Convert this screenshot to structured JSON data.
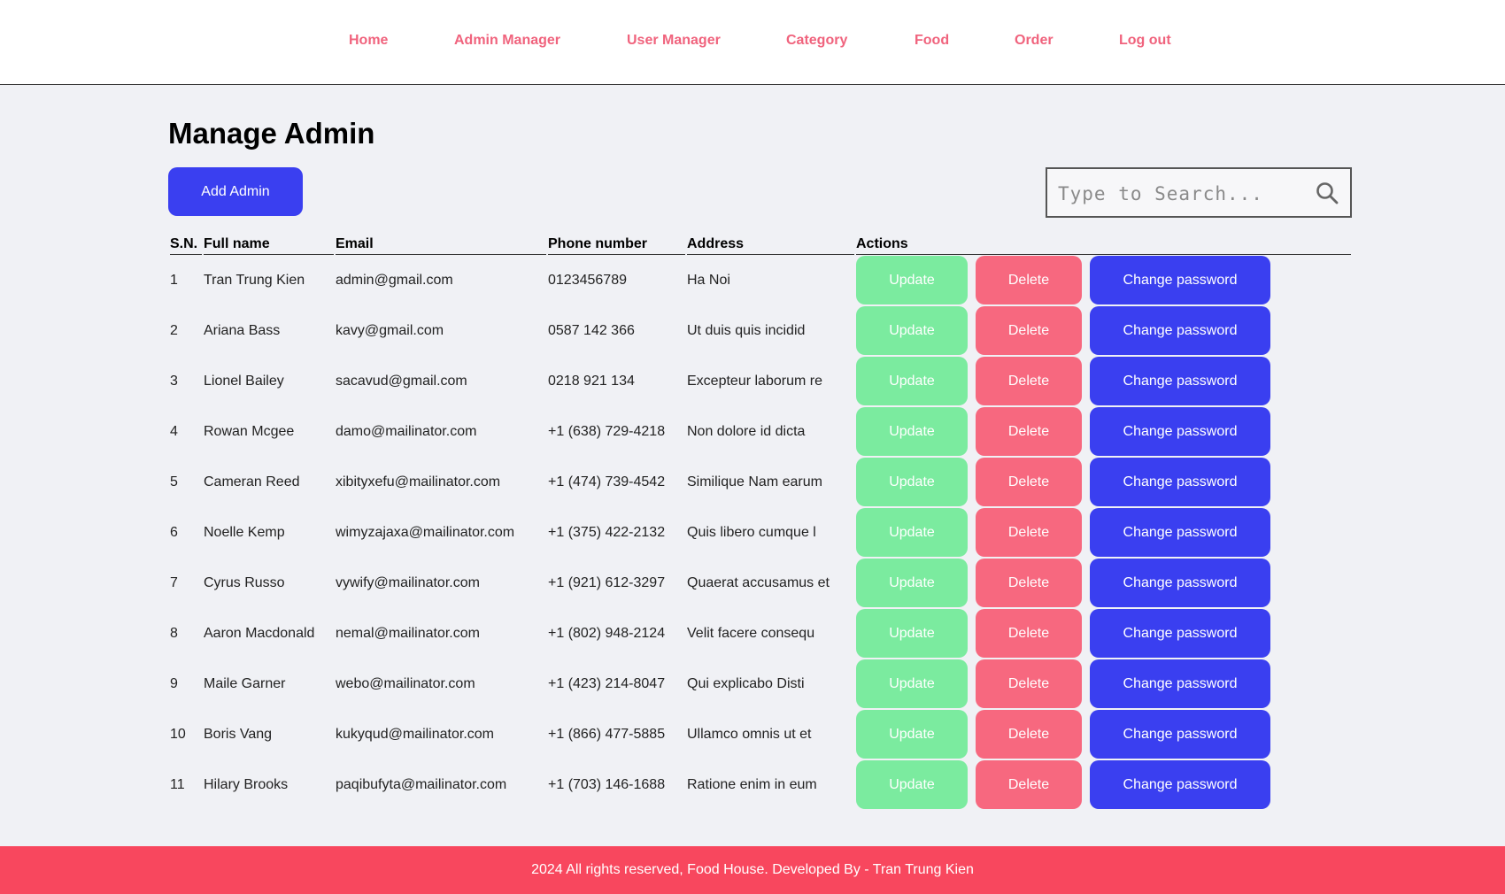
{
  "nav": {
    "items": [
      {
        "label": "Home"
      },
      {
        "label": "Admin Manager"
      },
      {
        "label": "User Manager"
      },
      {
        "label": "Category"
      },
      {
        "label": "Food"
      },
      {
        "label": "Order"
      },
      {
        "label": "Log out"
      }
    ]
  },
  "page": {
    "title": "Manage Admin",
    "add_button": "Add Admin"
  },
  "search": {
    "placeholder": "Type to Search...",
    "icon": "search-icon"
  },
  "table": {
    "headers": {
      "sn": "S.N.",
      "name": "Full name",
      "email": "Email",
      "phone": "Phone number",
      "address": "Address",
      "actions": "Actions"
    },
    "action_labels": {
      "update": "Update",
      "delete": "Delete",
      "change_password": "Change password"
    },
    "rows": [
      {
        "sn": "1",
        "name": "Tran Trung Kien",
        "email": "admin@gmail.com",
        "phone": "0123456789",
        "address": "Ha Noi"
      },
      {
        "sn": "2",
        "name": "Ariana Bass",
        "email": "kavy@gmail.com",
        "phone": "0587 142 366",
        "address": "Ut duis quis incidid"
      },
      {
        "sn": "3",
        "name": "Lionel Bailey",
        "email": "sacavud@gmail.com",
        "phone": "0218 921 134",
        "address": "Excepteur laborum re"
      },
      {
        "sn": "4",
        "name": "Rowan Mcgee",
        "email": "damo@mailinator.com",
        "phone": "+1 (638) 729-4218",
        "address": "Non dolore id dicta"
      },
      {
        "sn": "5",
        "name": "Cameran Reed",
        "email": "xibityxefu@mailinator.com",
        "phone": "+1 (474) 739-4542",
        "address": "Similique Nam earum"
      },
      {
        "sn": "6",
        "name": "Noelle Kemp",
        "email": "wimyzajaxa@mailinator.com",
        "phone": "+1 (375) 422-2132",
        "address": "Quis libero cumque l"
      },
      {
        "sn": "7",
        "name": "Cyrus Russo",
        "email": "vywify@mailinator.com",
        "phone": "+1 (921) 612-3297",
        "address": "Quaerat accusamus et"
      },
      {
        "sn": "8",
        "name": "Aaron Macdonald",
        "email": "nemal@mailinator.com",
        "phone": "+1 (802) 948-2124",
        "address": "Velit facere consequ"
      },
      {
        "sn": "9",
        "name": "Maile Garner",
        "email": "webo@mailinator.com",
        "phone": "+1 (423) 214-8047",
        "address": "Qui explicabo Disti"
      },
      {
        "sn": "10",
        "name": "Boris Vang",
        "email": "kukyqud@mailinator.com",
        "phone": "+1 (866) 477-5885",
        "address": "Ullamco omnis ut et"
      },
      {
        "sn": "11",
        "name": "Hilary Brooks",
        "email": "paqibufyta@mailinator.com",
        "phone": "+1 (703) 146-1688",
        "address": "Ratione enim in eum"
      }
    ]
  },
  "footer": {
    "text": "2024 All rights reserved, Food House. Developed By - Tran Trung Kien"
  },
  "colors": {
    "accent_blue": "#3a3ff0",
    "nav_pink": "#f0637d",
    "update_green": "#7beb9f",
    "delete_pink": "#f7687f",
    "footer_red": "#f8475e",
    "background": "#f0f1f5"
  }
}
